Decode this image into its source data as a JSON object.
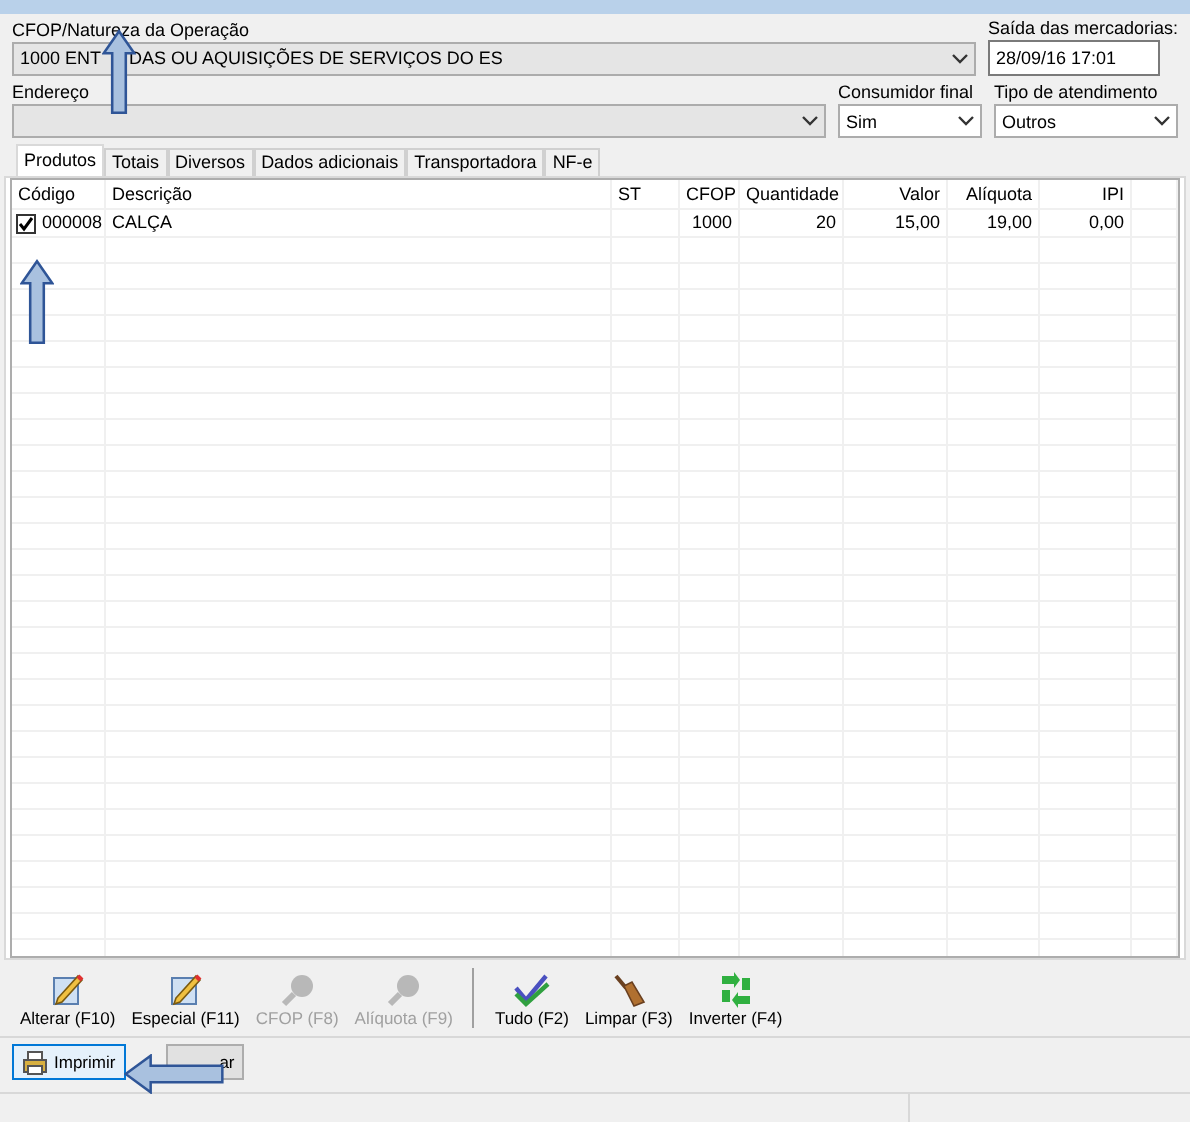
{
  "operation": {
    "label": "CFOP/Natureza da Operação",
    "value": "1000 ENT",
    "value_after_arrow": "DAS OU AQUISIÇÕES DE SERVIÇOS DO ES"
  },
  "departure": {
    "label": "Saída das mercadorias:",
    "value": "28/09/16 17:01"
  },
  "address": {
    "label": "Endereço"
  },
  "final_consumer": {
    "label": "Consumidor final",
    "value": "Sim"
  },
  "service_type": {
    "label": "Tipo de atendimento",
    "value": "Outros"
  },
  "tabs": [
    {
      "label": "Produtos",
      "selected": true
    },
    {
      "label": "Totais",
      "selected": false
    },
    {
      "label": "Diversos",
      "selected": false
    },
    {
      "label": "Dados adicionais",
      "selected": false
    },
    {
      "label": "Transportadora",
      "selected": false
    },
    {
      "label": "NF-e",
      "selected": false
    }
  ],
  "table": {
    "columns": [
      "Código",
      "Descrição",
      "ST",
      "CFOP",
      "Quantidade",
      "Valor",
      "Alíquota",
      "IPI"
    ],
    "rows": [
      {
        "checked": true,
        "cells": [
          "000008",
          "CALÇA",
          "",
          "1000",
          "20",
          "15,00",
          "19,00",
          "0,00"
        ]
      }
    ]
  },
  "toolbar": [
    {
      "label": "Alterar (F10)",
      "kind": "edit",
      "disabled": false,
      "separator_before": false
    },
    {
      "label": "Especial (F11)",
      "kind": "edit",
      "disabled": false,
      "separator_before": false
    },
    {
      "label": "CFOP (F8)",
      "kind": "magnifier",
      "disabled": true,
      "separator_before": false
    },
    {
      "label": "Alíquota (F9)",
      "kind": "magnifier",
      "disabled": true,
      "separator_before": false
    },
    {
      "label": "Tudo (F2)",
      "kind": "checks",
      "disabled": false,
      "separator_before": true
    },
    {
      "label": "Limpar (F3)",
      "kind": "broom",
      "disabled": false,
      "separator_before": false
    },
    {
      "label": "Inverter (F4)",
      "kind": "swap",
      "disabled": false,
      "separator_before": false
    }
  ],
  "buttons": [
    {
      "label": "Imprimir",
      "kind": "print"
    },
    {
      "label": "ar",
      "kind": "plain"
    }
  ],
  "annotations": [
    {
      "kind": "arrow-up"
    },
    {
      "kind": "arrow-up"
    },
    {
      "kind": "arrow-left"
    }
  ]
}
